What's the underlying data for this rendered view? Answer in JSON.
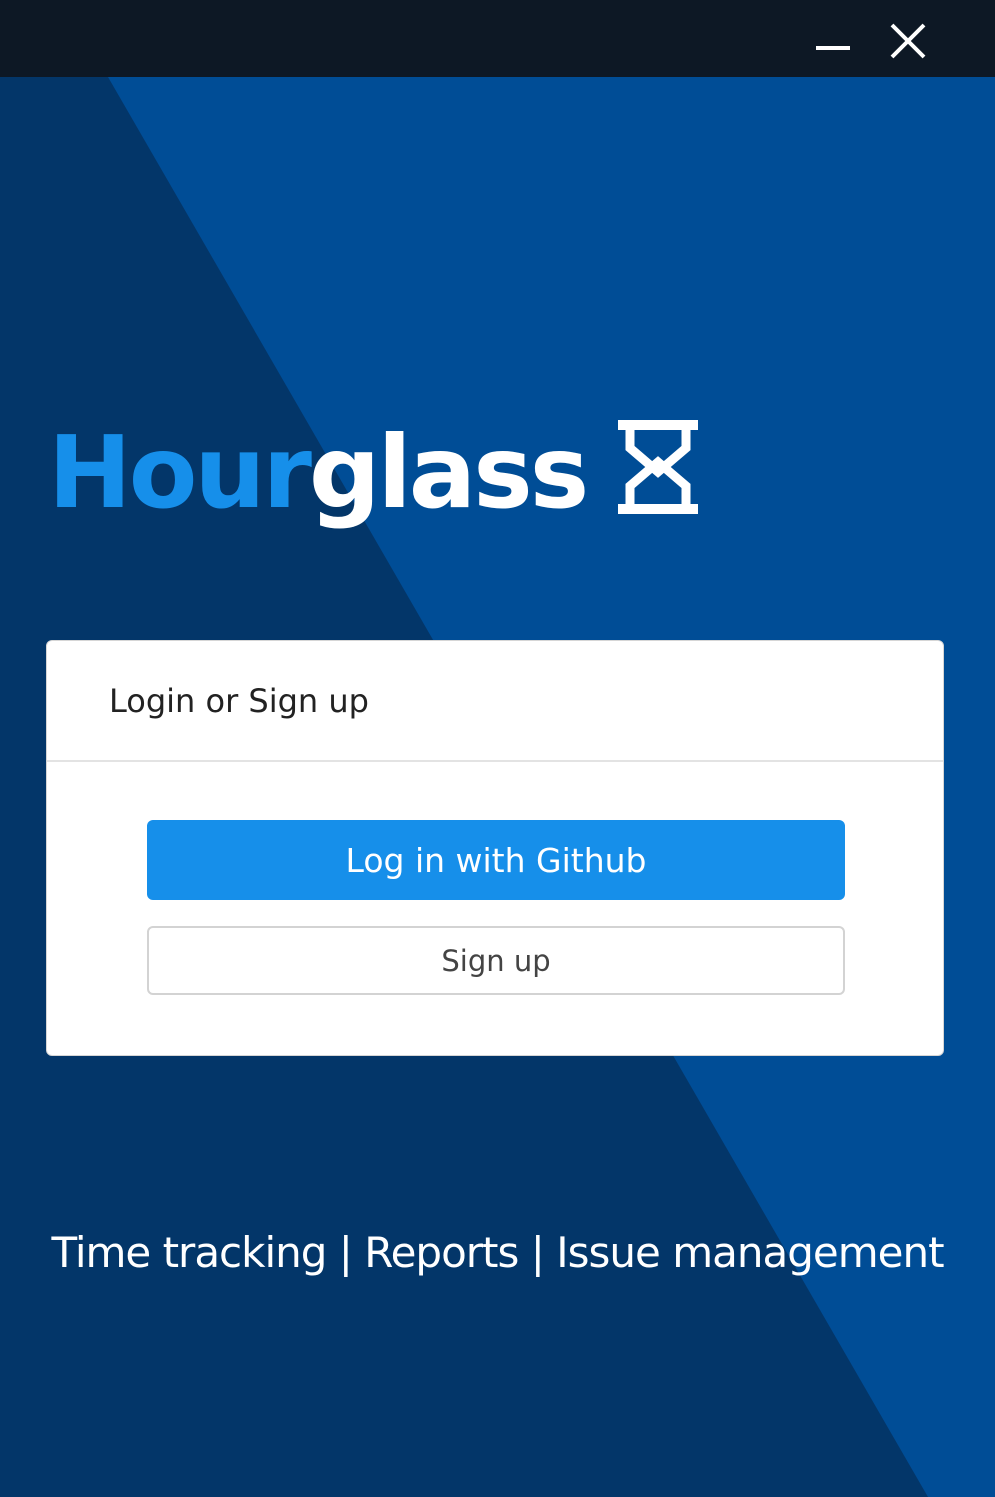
{
  "window": {
    "minimize_icon": "minimize-icon",
    "close_icon": "close-icon"
  },
  "brand": {
    "part1": "Hour",
    "part2": "glass",
    "icon": "hourglass-icon"
  },
  "card": {
    "title": "Login or Sign up",
    "github_button": "Log in with Github",
    "signup_button": "Sign up"
  },
  "tagline": "Time tracking | Reports | Issue management",
  "colors": {
    "titlebar": "#0d1825",
    "background_dark": "#033669",
    "background_light": "#004d96",
    "accent": "#168fea"
  }
}
